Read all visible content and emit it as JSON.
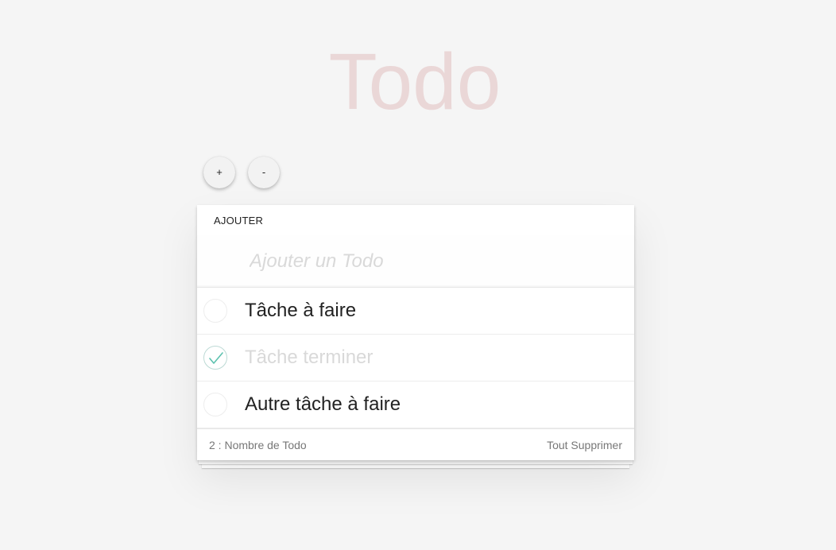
{
  "app": {
    "title": "Todo"
  },
  "controls": {
    "add_label": "+",
    "remove_label": "-"
  },
  "card": {
    "header_label": "AJOUTER",
    "new_todo_placeholder": "Ajouter un Todo",
    "new_todo_value": ""
  },
  "todos": [
    {
      "label": "Tâche à faire",
      "completed": false
    },
    {
      "label": "Tâche terminer",
      "completed": true
    },
    {
      "label": "Autre tâche à faire",
      "completed": false
    }
  ],
  "footer": {
    "count_text": "2 : Nombre de Todo",
    "clear_label": "Tout Supprimer"
  },
  "colors": {
    "title": "#efd5d5",
    "check": "#5dc2af",
    "background": "#f5f5f5"
  },
  "icons": {
    "toggle_checked": "check-icon",
    "toggle_unchecked": "empty-circle-icon"
  }
}
